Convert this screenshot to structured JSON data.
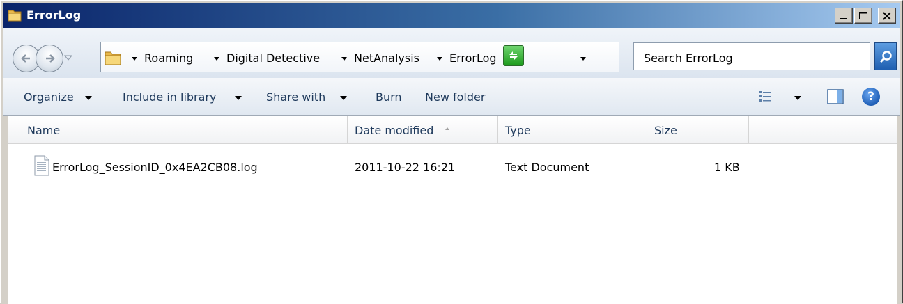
{
  "window": {
    "title": "ErrorLog"
  },
  "address": {
    "breadcrumbs": [
      "Roaming",
      "Digital Detective",
      "NetAnalysis",
      "ErrorLog"
    ]
  },
  "search": {
    "placeholder": "Search ErrorLog"
  },
  "toolbar": {
    "organize": "Organize",
    "include_in_library": "Include in library",
    "share_with": "Share with",
    "burn": "Burn",
    "new_folder": "New folder"
  },
  "columns": {
    "name": "Name",
    "date_modified": "Date modified",
    "type": "Type",
    "size": "Size"
  },
  "files": [
    {
      "name": "ErrorLog_SessionID_0x4EA2CB08.log",
      "date_modified": "2011-10-22 16:21",
      "type": "Text Document",
      "size": "1 KB"
    }
  ],
  "icons": {
    "title": "folder-icon",
    "help": "?"
  }
}
